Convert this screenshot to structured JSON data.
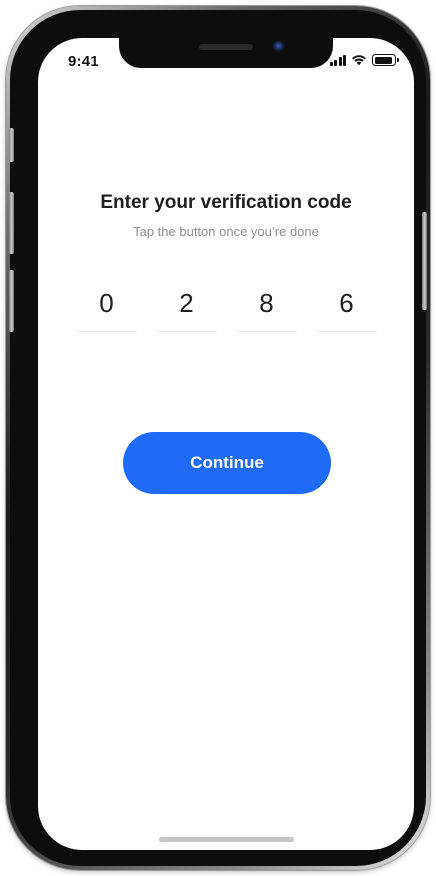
{
  "status_bar": {
    "time": "9:41",
    "icons": [
      "cellular-signal-icon",
      "wifi-icon",
      "battery-icon"
    ],
    "battery_level": 0.9
  },
  "verification": {
    "title": "Enter your verification code",
    "subtitle": "Tap the button once you’re done",
    "digits": [
      "0",
      "2",
      "8",
      "6"
    ]
  },
  "actions": {
    "continue_label": "Continue"
  },
  "colors": {
    "accent": "#1f6bf5",
    "title_text": "#1e1e1e",
    "subtitle_text": "#8e8e93",
    "underline": "#ececec",
    "home_indicator": "#c6c6c6"
  }
}
